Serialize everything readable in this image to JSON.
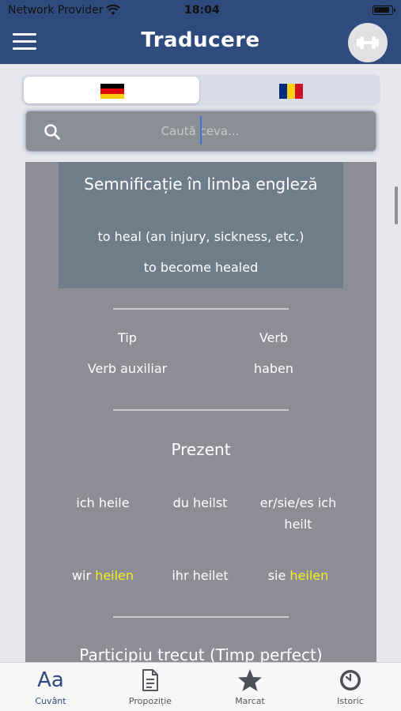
{
  "status": {
    "carrier": "Network Provider",
    "time": "18:04"
  },
  "nav": {
    "title": "Traducere"
  },
  "language_toggle": {
    "source_flag": "germany-flag",
    "target_flag": "romania-flag",
    "selected": "source"
  },
  "search": {
    "placeholder": "Caută ceva..."
  },
  "meaning": {
    "title": "Semnificație în limba engleză",
    "items": [
      "to heal (an injury, sickness, etc.)",
      "to become healed"
    ]
  },
  "info": {
    "type_label": "Tip",
    "type_value": "Verb",
    "aux_label": "Verb auxiliar",
    "aux_value": "haben"
  },
  "present": {
    "title": "Prezent",
    "forms": [
      {
        "pronoun": "ich",
        "verb": "heile",
        "highlight": false
      },
      {
        "pronoun": "du",
        "verb": "heilst",
        "highlight": false
      },
      {
        "pronoun": "er/sie/es",
        "verb": "ich heilt",
        "highlight": false
      },
      {
        "pronoun": "wir",
        "verb": "heilen",
        "highlight": true
      },
      {
        "pronoun": "ihr",
        "verb": "heilet",
        "highlight": false
      },
      {
        "pronoun": "sie",
        "verb": "heilen",
        "highlight": true
      }
    ]
  },
  "next_section": {
    "title": "Participiu trecut (Timp perfect)"
  },
  "tabs": [
    {
      "label": "Cuvânt",
      "icon": "font-size-icon",
      "glyph": "Aa",
      "active": true
    },
    {
      "label": "Propoziție",
      "icon": "document-icon",
      "active": false
    },
    {
      "label": "Marcat",
      "icon": "star-icon",
      "active": false
    },
    {
      "label": "Istoric",
      "icon": "clock-icon",
      "active": false
    }
  ],
  "colors": {
    "primary": "#2f4a7c",
    "highlight": "#f2ef1e",
    "card": "#8d8e95",
    "meaning_box": "#6f7c89"
  }
}
